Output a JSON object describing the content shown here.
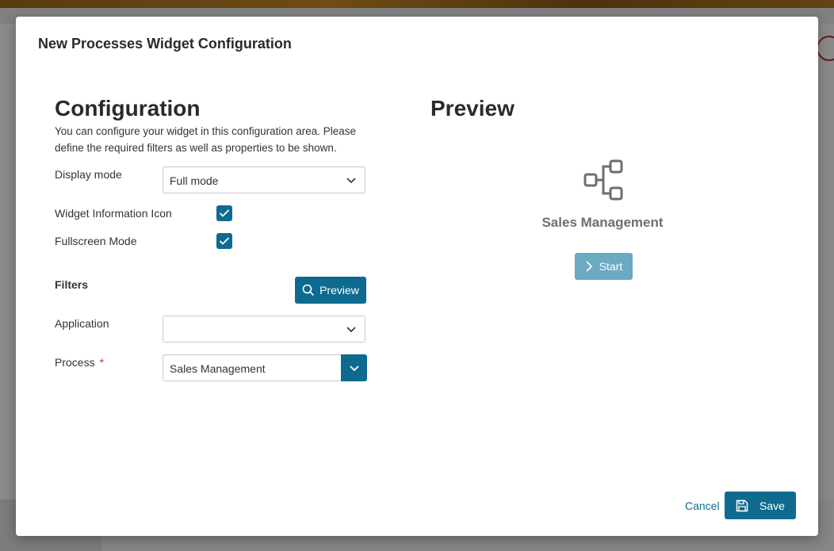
{
  "dialog": {
    "title": "New Processes Widget Configuration"
  },
  "configuration": {
    "heading": "Configuration",
    "description": "You can configure your widget in this configuration area. Please define the required filters as well as properties to be shown.",
    "display_mode_label": "Display mode",
    "display_mode_value": "Full mode",
    "widget_info_icon_label": "Widget Information Icon",
    "widget_info_icon_checked": true,
    "fullscreen_mode_label": "Fullscreen Mode",
    "fullscreen_mode_checked": true,
    "filters_label": "Filters",
    "preview_button_label": "Preview",
    "application_label": "Application",
    "application_value": "",
    "process_label": "Process",
    "process_required_mark": "*",
    "process_value": "Sales Management"
  },
  "preview": {
    "heading": "Preview",
    "process_name": "Sales Management",
    "start_button_label": "Start",
    "process_icon": "process-flow-icon"
  },
  "footer": {
    "cancel_label": "Cancel",
    "save_label": "Save"
  },
  "colors": {
    "primary": "#0e6b8f",
    "primary_disabled": "#6aaac3",
    "required": "#c0392b"
  }
}
